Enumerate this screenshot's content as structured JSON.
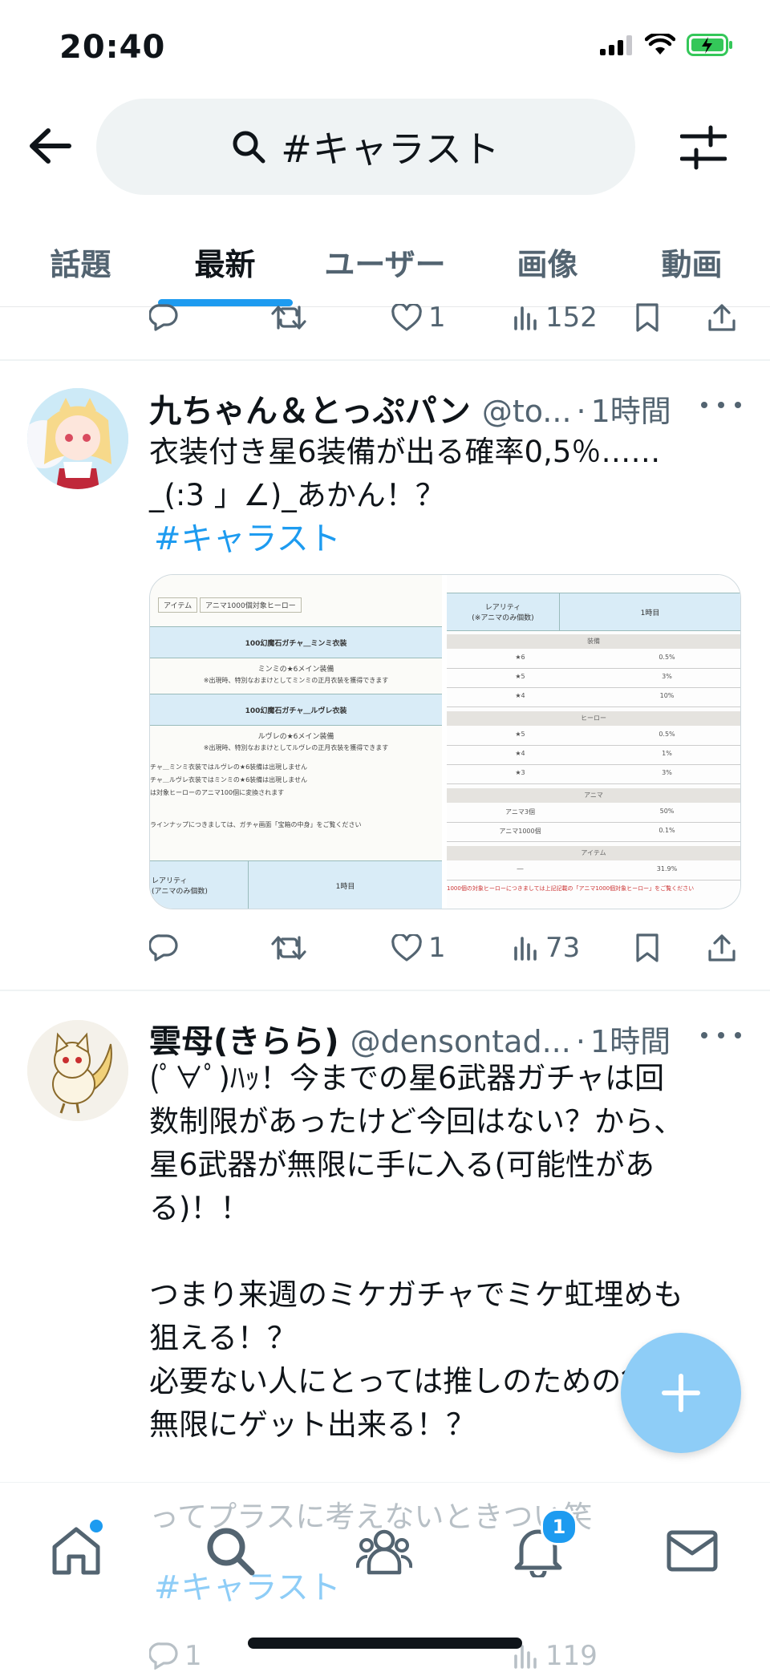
{
  "status_bar": {
    "time": "20:40"
  },
  "search": {
    "query": "#キャラスト"
  },
  "tabs": [
    "話題",
    "最新",
    "ユーザー",
    "画像",
    "動画"
  ],
  "active_tab": "最新",
  "prev_tweet_actions": {
    "replies": "",
    "retweets": "",
    "likes": "1",
    "views": "152"
  },
  "tweets": [
    {
      "name": "九ちゃん＆とっぷパン",
      "handle": "@to...",
      "time": "1時間",
      "text": "衣装付き星6装備が出る確率0,5％……\n_(:3 」∠)_あかん！？",
      "hashtag": "#キャラスト",
      "likes": "1",
      "views": "73",
      "media": {
        "left_panel": {
          "tabs": [
            "アイテム",
            "アニマ1000個対象ヒーロー"
          ],
          "rows": [
            "100幻魔石ガチャ＿ミンミ衣装",
            "ミンミの★6メイン装備",
            "※出現時、特別なおまけとしてミンミの正月衣装を獲得できます",
            "100幻魔石ガチャ＿ルヴレ衣装",
            "ルヴレの★6メイン装備",
            "※出現時、特別なおまけとしてルヴレの正月衣装を獲得できます",
            "チャ＿ミンミ衣装ではルヴレの★6装備は出現しません",
            "チャ＿ルヴレ衣装ではミンミの★6装備は出現しません",
            "は対象ヒーローのアニマ100個に変換されます",
            "ラインナップにつきましては、ガチャ画面「宝箱の中身」をご覧ください",
            "レアリティ\n(アニマのみ個数)",
            "1時目"
          ]
        },
        "right_panel": {
          "header": [
            "レアリティ\n(※アニマのみ個数)",
            "1時目"
          ],
          "sections": [
            {
              "label": "装備",
              "rows": [
                [
                  "★6",
                  "0.5%"
                ],
                [
                  "★5",
                  "3%"
                ],
                [
                  "★4",
                  "10%"
                ]
              ]
            },
            {
              "label": "ヒーロー",
              "rows": [
                [
                  "★5",
                  "0.5%"
                ],
                [
                  "★4",
                  "1%"
                ],
                [
                  "★3",
                  "3%"
                ]
              ]
            },
            {
              "label": "アニマ",
              "rows": [
                [
                  "アニマ3個",
                  "50%"
                ],
                [
                  "アニマ1000個",
                  "0.1%"
                ]
              ]
            },
            {
              "label": "アイテム",
              "rows": [
                [
                  "―",
                  "31.9%"
                ]
              ]
            }
          ],
          "footer": "1000個の対象ヒーローにつきましては上記記載の「アニマ1000個対象ヒーロー」をご覧ください"
        }
      }
    },
    {
      "name": "雲母(きらら)",
      "handle": "@densontad...",
      "time": "1時間",
      "text": "(ﾟ∀ﾟ)ﾊｯ！今までの星6武器ガチャは回\n数制限があったけど今回はない？から、\n星6武器が無限に手に入る(可能性があ\nる)！！\n\nつまり来週のミケガチャでミケ虹埋めも\n狙える！？\n必要ない人にとっては推しのための餌を\n無限にゲット出来る！？",
      "continuation": "ってプラスに考えないときつい笑",
      "hashtag": "#キャラスト",
      "replies": "1",
      "views": "119"
    }
  ],
  "bottom_nav": {
    "notification_badge": "1"
  },
  "colors": {
    "accent": "#1d9bf0",
    "fab": "#8ecdf7",
    "muted": "#536471"
  },
  "icons": [
    "back-arrow-icon",
    "search-icon",
    "filter-icon",
    "reply-icon",
    "retweet-icon",
    "like-icon",
    "views-icon",
    "bookmark-icon",
    "share-icon",
    "more-icon",
    "plus-icon",
    "home-icon",
    "communities-icon",
    "bell-icon",
    "mail-icon"
  ]
}
